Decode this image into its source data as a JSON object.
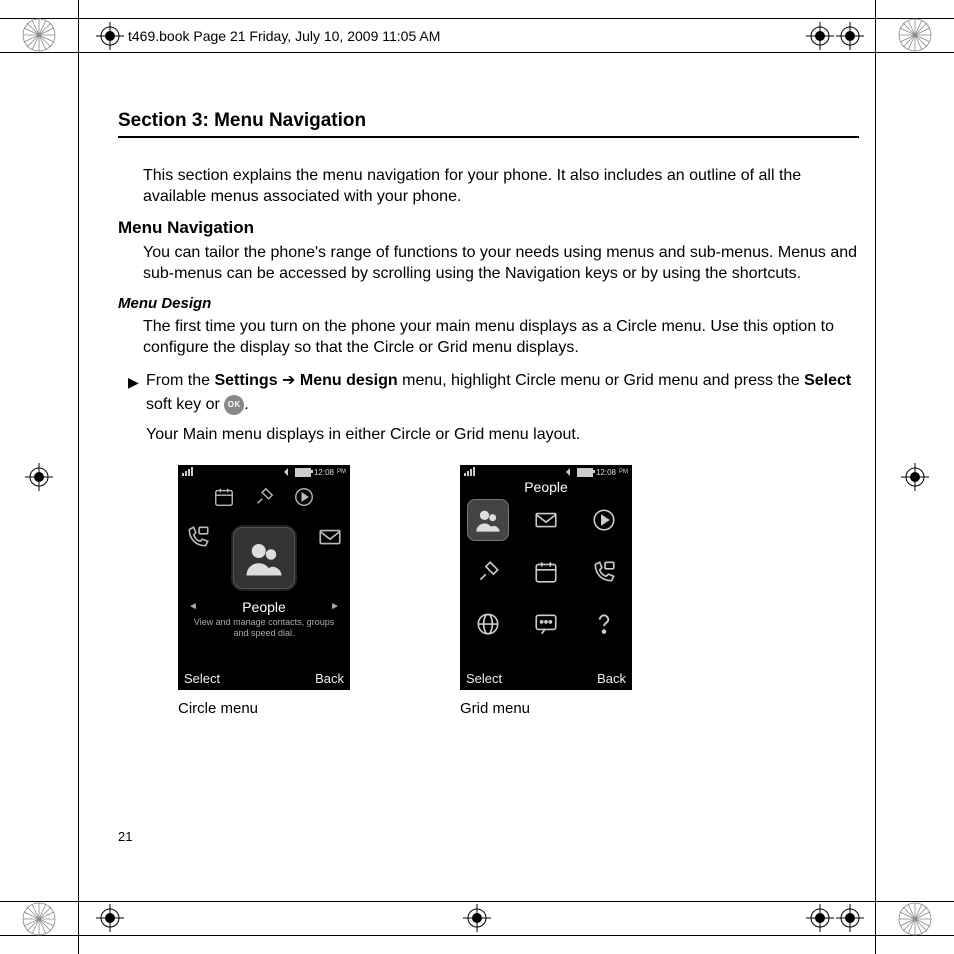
{
  "header_line": "t469.book  Page 21  Friday, July 10, 2009  11:05 AM",
  "section_title": "Section 3: Menu Navigation",
  "intro": "This section explains the menu navigation for your phone. It also includes an outline of all the available menus associated with your phone.",
  "sub_heading": "Menu Navigation",
  "sub_body": "You can tailor the phone's range of functions to your needs using menus and sub-menus. Menus and sub-menus can be accessed by scrolling using the Navigation keys or by using the shortcuts.",
  "sub_sub_heading": "Menu Design",
  "design_body": "The first time you turn on the phone your main menu displays as a Circle menu. Use this option to configure the display so that the Circle or Grid menu displays.",
  "step": {
    "prefix": "From the ",
    "bold1": "Settings",
    "arrow": " ➔ ",
    "bold2": "Menu design",
    "mid": " menu, highlight Circle menu or Grid menu and press the ",
    "bold3": "Select",
    "suffix1": " soft key or ",
    "ok_label": "OK",
    "suffix2": ".",
    "line2": "Your Main menu displays in either Circle or Grid menu layout."
  },
  "circle": {
    "caption": "Circle menu",
    "time": "12:08",
    "ampm": "PM",
    "title": "People",
    "desc": "View and manage contacts, groups and speed dial.",
    "soft_left": "Select",
    "soft_right": "Back"
  },
  "grid": {
    "caption": "Grid menu",
    "time": "12:08",
    "ampm": "PM",
    "title": "People",
    "soft_left": "Select",
    "soft_right": "Back"
  },
  "page_num": "21"
}
